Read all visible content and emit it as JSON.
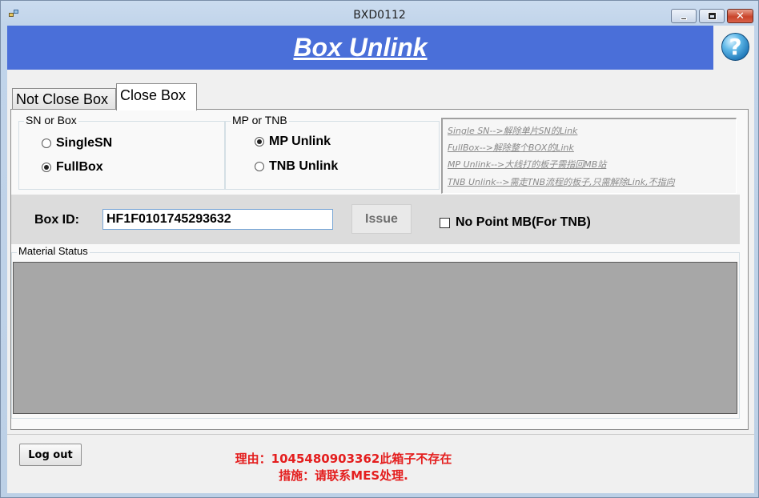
{
  "window": {
    "title": "BXD0112",
    "controls": {
      "minimize_icon": "minimize-icon",
      "maximize_icon": "maximize-icon",
      "close_icon": "close-icon",
      "close_glyph": "✕"
    }
  },
  "header": {
    "title": "Box Unlink",
    "help_glyph": "?",
    "bg_color": "#4a6fd9"
  },
  "tabs": [
    {
      "label": "Not Close Box",
      "active": false
    },
    {
      "label": "Close Box",
      "active": true
    }
  ],
  "sn_or_box": {
    "title": "SN or Box",
    "options": [
      {
        "label": "SingleSN",
        "checked": false
      },
      {
        "label": "FullBox",
        "checked": true
      }
    ]
  },
  "mp_or_tnb": {
    "title": "MP or TNB",
    "options": [
      {
        "label": "MP Unlink",
        "checked": true
      },
      {
        "label": "TNB Unlink",
        "checked": false
      }
    ]
  },
  "notes": [
    "Single SN-->解除单片SN的Link",
    "FullBox-->解除整个BOX的Link",
    "MP Unlink-->大线打的板子需指回MB站",
    "TNB Unlink-->需走TNB流程的板子,只需解除Link,不指向"
  ],
  "box": {
    "label": "Box ID:",
    "value": "HF1F0101745293632",
    "issue_label": "Issue",
    "no_point_label": "No Point MB(For TNB)",
    "no_point_checked": false
  },
  "material_status": {
    "title": "Material Status"
  },
  "footer": {
    "logout_label": "Log out",
    "message_line1": "理由：1045480903362此箱子不存在",
    "message_line2": "措施：请联系MES处理.",
    "message_color": "#e41e1e"
  }
}
